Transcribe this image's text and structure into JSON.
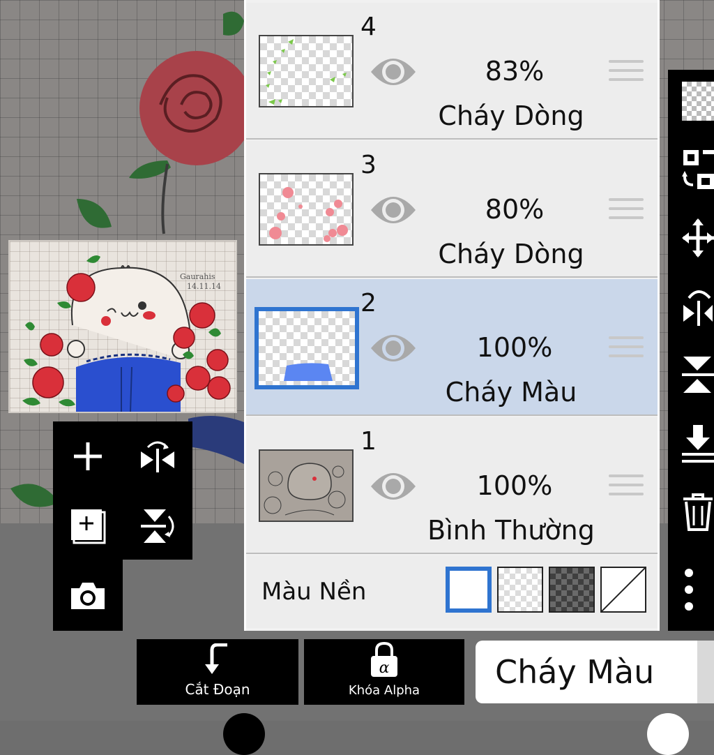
{
  "layers": [
    {
      "number": "4",
      "opacity": "83%",
      "blend": "Cháy Dòng",
      "visible": true,
      "selected": false
    },
    {
      "number": "3",
      "opacity": "80%",
      "blend": "Cháy Dòng",
      "visible": true,
      "selected": false
    },
    {
      "number": "2",
      "opacity": "100%",
      "blend": "Cháy Màu",
      "visible": true,
      "selected": true
    },
    {
      "number": "1",
      "opacity": "100%",
      "blend": "Bình Thường",
      "visible": true,
      "selected": false
    }
  ],
  "background": {
    "label": "Màu Nền",
    "options": [
      "white",
      "light-checker",
      "dark-checker",
      "none"
    ],
    "selected": "white"
  },
  "left_tools": [
    "add-layer-icon",
    "flip-horizontal-icon",
    "duplicate-layer-icon",
    "flip-vertical-icon",
    "camera-icon"
  ],
  "right_tools": [
    "transparent-icon",
    "qr-transform-icon",
    "move-icon",
    "flip-horizontal-icon",
    "flip-vertical-icon",
    "merge-down-icon",
    "trash-icon",
    "more-icon"
  ],
  "bottom": {
    "clip_label": "Cắt Đoạn",
    "alpha_lock_label": "Khóa Alpha",
    "blend_mode_value": "Cháy Màu"
  },
  "preview": {
    "signature_line1": "Gaurahis",
    "signature_line2": "14.11.14"
  },
  "colors": {
    "selected_row": "#cad7ea",
    "accent_blue": "#2f74d0",
    "rose_red": "#d9303a",
    "leaf_green": "#2f8a34",
    "shirt_blue": "#2a4fcf"
  }
}
